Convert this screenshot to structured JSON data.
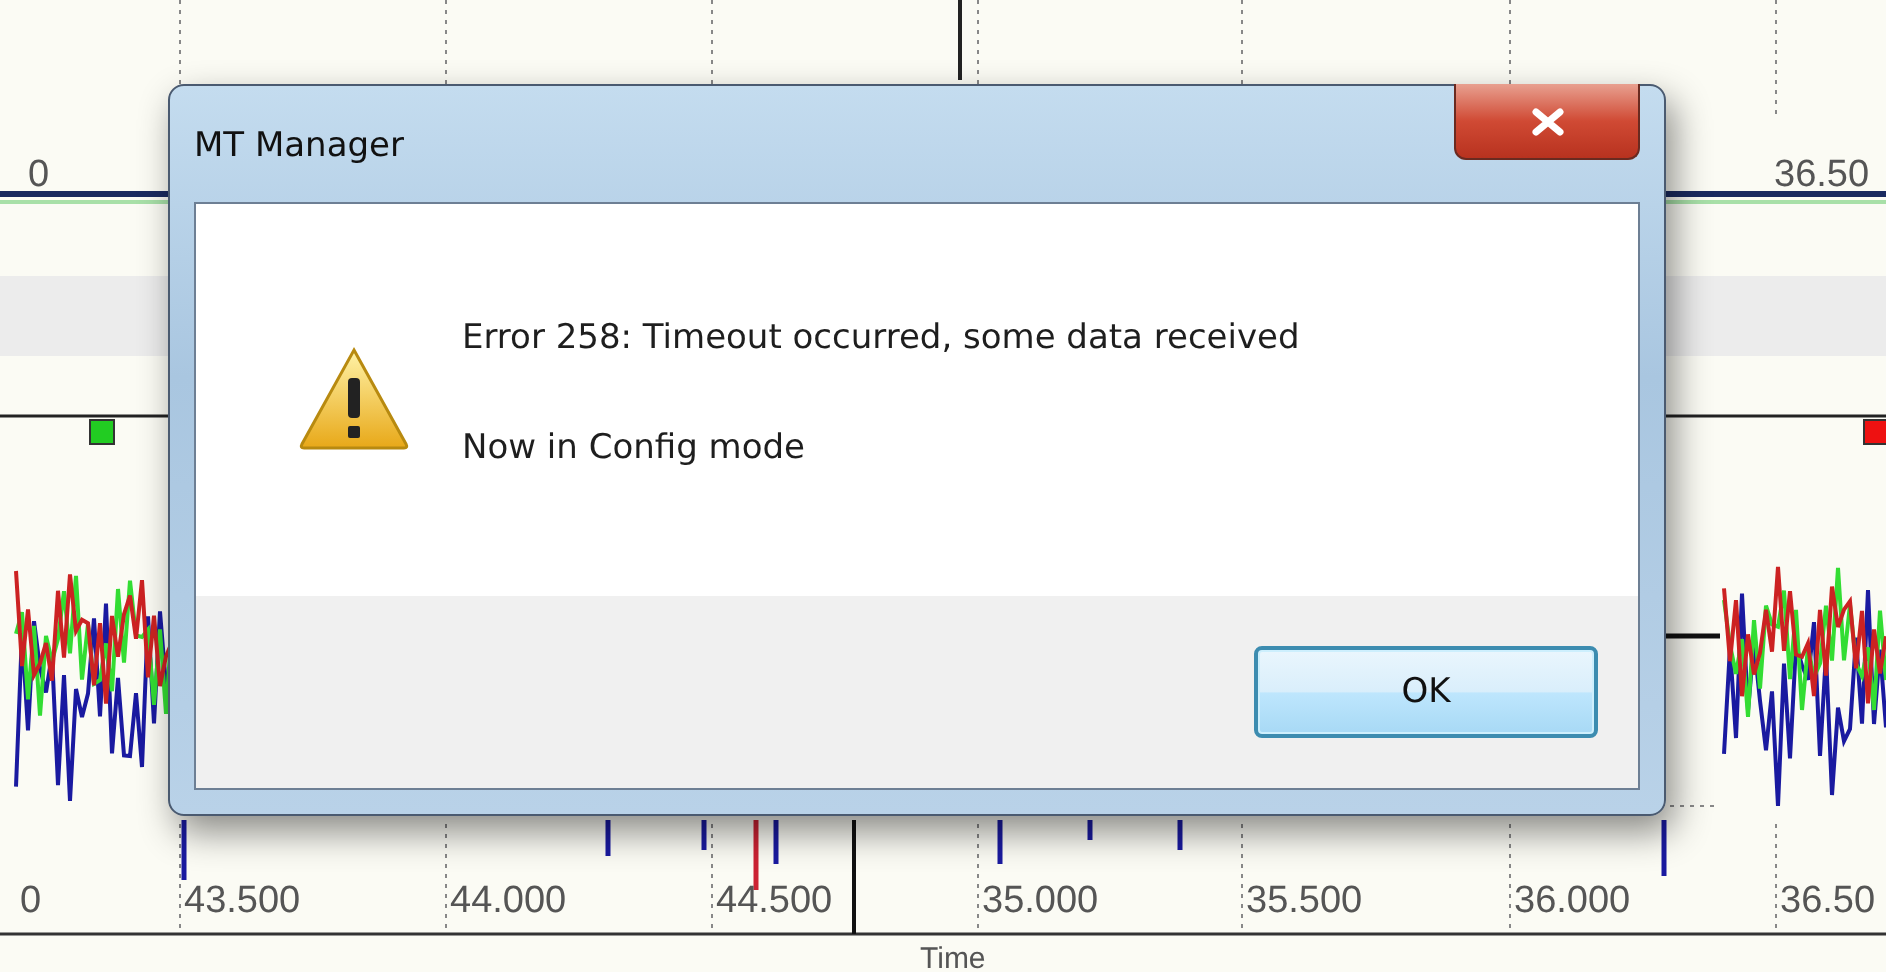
{
  "chart": {
    "top_labels": [
      "0",
      "36.50"
    ],
    "legend": [
      {
        "color": "#22cc22"
      },
      {
        "color": "#ee1111"
      }
    ],
    "x_labels": [
      "0",
      "43.500",
      "44.000",
      "44.500",
      "35.000",
      "35.500",
      "36.000",
      "36.50"
    ],
    "x_title": "Time"
  },
  "dialog": {
    "title": "MT Manager",
    "icon": {
      "kind": "warning"
    },
    "messages": [
      "Error 258: Timeout occurred, some data received",
      "Now in Config mode"
    ],
    "buttons": [
      "OK"
    ]
  }
}
